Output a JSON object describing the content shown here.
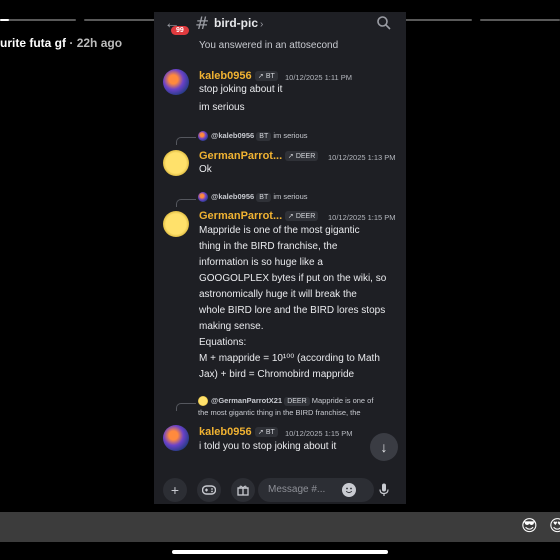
{
  "story": {
    "title": "urite futa gf",
    "time_ago": "22h ago",
    "progress_bars": [
      1,
      0,
      0,
      0,
      0,
      0
    ]
  },
  "channel": {
    "name": "bird-pic",
    "notification_count": "99",
    "back_icon": "arrow-left-icon",
    "search_icon": "search-icon"
  },
  "system_message": "You answered in an attosecond",
  "messages": [
    {
      "author": "kaleb0956",
      "author_color": "#f0b232",
      "tag": "BT",
      "timestamp": "10/12/2025 1:11 PM",
      "lines": [
        "stop joking about it",
        "im serious"
      ]
    },
    {
      "reply_to_author": "@kaleb0956",
      "reply_to_tag": "BT",
      "reply_to_text": "im serious",
      "author": "GermanParrot...",
      "author_color": "#f0b232",
      "tag": "DEER",
      "timestamp": "10/12/2025 1:13 PM",
      "lines": [
        "Ok"
      ]
    },
    {
      "reply_to_author": "@kaleb0956",
      "reply_to_tag": "BT",
      "reply_to_text": "im serious",
      "author": "GermanParrot...",
      "author_color": "#f0b232",
      "tag": "DEER",
      "timestamp": "10/12/2025 1:15 PM",
      "lines": [
        "Mappride is one of the most gigantic",
        "thing in the BIRD franchise, the",
        "information is so huge like a",
        "GOOGOLPLEX bytes if put on the wiki, so",
        "astronomically huge it will break the",
        "whole BIRD lore and the BIRD lores stops",
        "making sense.",
        "Equations:",
        "M + mappride = 10¹⁰⁰ (according to Math",
        "Jax) + bird = Chromobird mappride"
      ]
    },
    {
      "reply_to_author": "@GermanParrotX21",
      "reply_to_tag": "DEER",
      "reply_to_text": "Mappride is one of",
      "reply_to_text_2": "the most gigantic thing in the BIRD franchise, the",
      "author": "kaleb0956",
      "author_color": "#f0b232",
      "tag": "BT",
      "timestamp": "10/12/2025 1:15 PM",
      "lines": [
        "i told you to stop joking about it"
      ]
    }
  ],
  "composer": {
    "placeholder": "Message #...",
    "add_icon": "plus-icon",
    "game_icon": "gamepad-icon",
    "gift_icon": "gift-icon",
    "emoji_icon": "smile-icon",
    "mic_icon": "microphone-icon"
  },
  "reactions": [
    "😎",
    "😍"
  ]
}
